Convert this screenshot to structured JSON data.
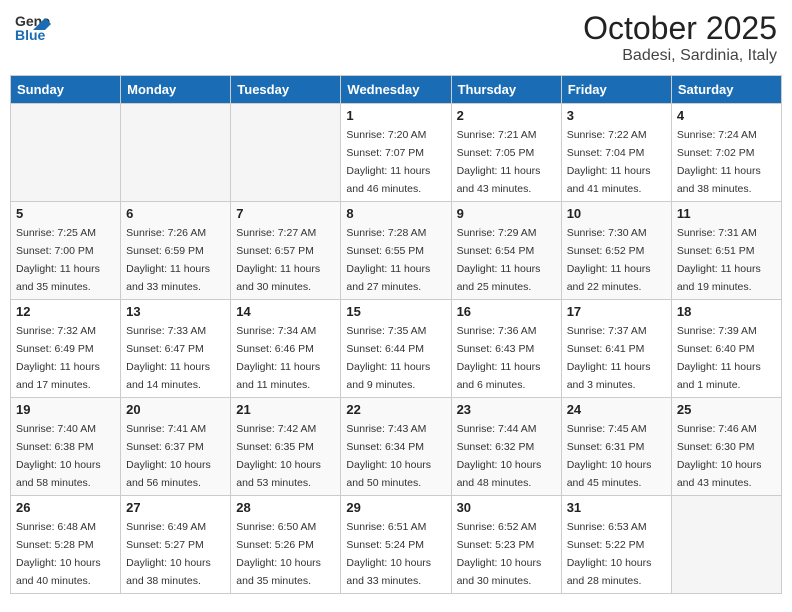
{
  "header": {
    "logo_general": "General",
    "logo_blue": "Blue",
    "month": "October 2025",
    "location": "Badesi, Sardinia, Italy"
  },
  "weekdays": [
    "Sunday",
    "Monday",
    "Tuesday",
    "Wednesday",
    "Thursday",
    "Friday",
    "Saturday"
  ],
  "weeks": [
    [
      {
        "day": "",
        "sunrise": "",
        "sunset": "",
        "daylight": ""
      },
      {
        "day": "",
        "sunrise": "",
        "sunset": "",
        "daylight": ""
      },
      {
        "day": "",
        "sunrise": "",
        "sunset": "",
        "daylight": ""
      },
      {
        "day": "1",
        "sunrise": "Sunrise: 7:20 AM",
        "sunset": "Sunset: 7:07 PM",
        "daylight": "Daylight: 11 hours and 46 minutes."
      },
      {
        "day": "2",
        "sunrise": "Sunrise: 7:21 AM",
        "sunset": "Sunset: 7:05 PM",
        "daylight": "Daylight: 11 hours and 43 minutes."
      },
      {
        "day": "3",
        "sunrise": "Sunrise: 7:22 AM",
        "sunset": "Sunset: 7:04 PM",
        "daylight": "Daylight: 11 hours and 41 minutes."
      },
      {
        "day": "4",
        "sunrise": "Sunrise: 7:24 AM",
        "sunset": "Sunset: 7:02 PM",
        "daylight": "Daylight: 11 hours and 38 minutes."
      }
    ],
    [
      {
        "day": "5",
        "sunrise": "Sunrise: 7:25 AM",
        "sunset": "Sunset: 7:00 PM",
        "daylight": "Daylight: 11 hours and 35 minutes."
      },
      {
        "day": "6",
        "sunrise": "Sunrise: 7:26 AM",
        "sunset": "Sunset: 6:59 PM",
        "daylight": "Daylight: 11 hours and 33 minutes."
      },
      {
        "day": "7",
        "sunrise": "Sunrise: 7:27 AM",
        "sunset": "Sunset: 6:57 PM",
        "daylight": "Daylight: 11 hours and 30 minutes."
      },
      {
        "day": "8",
        "sunrise": "Sunrise: 7:28 AM",
        "sunset": "Sunset: 6:55 PM",
        "daylight": "Daylight: 11 hours and 27 minutes."
      },
      {
        "day": "9",
        "sunrise": "Sunrise: 7:29 AM",
        "sunset": "Sunset: 6:54 PM",
        "daylight": "Daylight: 11 hours and 25 minutes."
      },
      {
        "day": "10",
        "sunrise": "Sunrise: 7:30 AM",
        "sunset": "Sunset: 6:52 PM",
        "daylight": "Daylight: 11 hours and 22 minutes."
      },
      {
        "day": "11",
        "sunrise": "Sunrise: 7:31 AM",
        "sunset": "Sunset: 6:51 PM",
        "daylight": "Daylight: 11 hours and 19 minutes."
      }
    ],
    [
      {
        "day": "12",
        "sunrise": "Sunrise: 7:32 AM",
        "sunset": "Sunset: 6:49 PM",
        "daylight": "Daylight: 11 hours and 17 minutes."
      },
      {
        "day": "13",
        "sunrise": "Sunrise: 7:33 AM",
        "sunset": "Sunset: 6:47 PM",
        "daylight": "Daylight: 11 hours and 14 minutes."
      },
      {
        "day": "14",
        "sunrise": "Sunrise: 7:34 AM",
        "sunset": "Sunset: 6:46 PM",
        "daylight": "Daylight: 11 hours and 11 minutes."
      },
      {
        "day": "15",
        "sunrise": "Sunrise: 7:35 AM",
        "sunset": "Sunset: 6:44 PM",
        "daylight": "Daylight: 11 hours and 9 minutes."
      },
      {
        "day": "16",
        "sunrise": "Sunrise: 7:36 AM",
        "sunset": "Sunset: 6:43 PM",
        "daylight": "Daylight: 11 hours and 6 minutes."
      },
      {
        "day": "17",
        "sunrise": "Sunrise: 7:37 AM",
        "sunset": "Sunset: 6:41 PM",
        "daylight": "Daylight: 11 hours and 3 minutes."
      },
      {
        "day": "18",
        "sunrise": "Sunrise: 7:39 AM",
        "sunset": "Sunset: 6:40 PM",
        "daylight": "Daylight: 11 hours and 1 minute."
      }
    ],
    [
      {
        "day": "19",
        "sunrise": "Sunrise: 7:40 AM",
        "sunset": "Sunset: 6:38 PM",
        "daylight": "Daylight: 10 hours and 58 minutes."
      },
      {
        "day": "20",
        "sunrise": "Sunrise: 7:41 AM",
        "sunset": "Sunset: 6:37 PM",
        "daylight": "Daylight: 10 hours and 56 minutes."
      },
      {
        "day": "21",
        "sunrise": "Sunrise: 7:42 AM",
        "sunset": "Sunset: 6:35 PM",
        "daylight": "Daylight: 10 hours and 53 minutes."
      },
      {
        "day": "22",
        "sunrise": "Sunrise: 7:43 AM",
        "sunset": "Sunset: 6:34 PM",
        "daylight": "Daylight: 10 hours and 50 minutes."
      },
      {
        "day": "23",
        "sunrise": "Sunrise: 7:44 AM",
        "sunset": "Sunset: 6:32 PM",
        "daylight": "Daylight: 10 hours and 48 minutes."
      },
      {
        "day": "24",
        "sunrise": "Sunrise: 7:45 AM",
        "sunset": "Sunset: 6:31 PM",
        "daylight": "Daylight: 10 hours and 45 minutes."
      },
      {
        "day": "25",
        "sunrise": "Sunrise: 7:46 AM",
        "sunset": "Sunset: 6:30 PM",
        "daylight": "Daylight: 10 hours and 43 minutes."
      }
    ],
    [
      {
        "day": "26",
        "sunrise": "Sunrise: 6:48 AM",
        "sunset": "Sunset: 5:28 PM",
        "daylight": "Daylight: 10 hours and 40 minutes."
      },
      {
        "day": "27",
        "sunrise": "Sunrise: 6:49 AM",
        "sunset": "Sunset: 5:27 PM",
        "daylight": "Daylight: 10 hours and 38 minutes."
      },
      {
        "day": "28",
        "sunrise": "Sunrise: 6:50 AM",
        "sunset": "Sunset: 5:26 PM",
        "daylight": "Daylight: 10 hours and 35 minutes."
      },
      {
        "day": "29",
        "sunrise": "Sunrise: 6:51 AM",
        "sunset": "Sunset: 5:24 PM",
        "daylight": "Daylight: 10 hours and 33 minutes."
      },
      {
        "day": "30",
        "sunrise": "Sunrise: 6:52 AM",
        "sunset": "Sunset: 5:23 PM",
        "daylight": "Daylight: 10 hours and 30 minutes."
      },
      {
        "day": "31",
        "sunrise": "Sunrise: 6:53 AM",
        "sunset": "Sunset: 5:22 PM",
        "daylight": "Daylight: 10 hours and 28 minutes."
      },
      {
        "day": "",
        "sunrise": "",
        "sunset": "",
        "daylight": ""
      }
    ]
  ]
}
